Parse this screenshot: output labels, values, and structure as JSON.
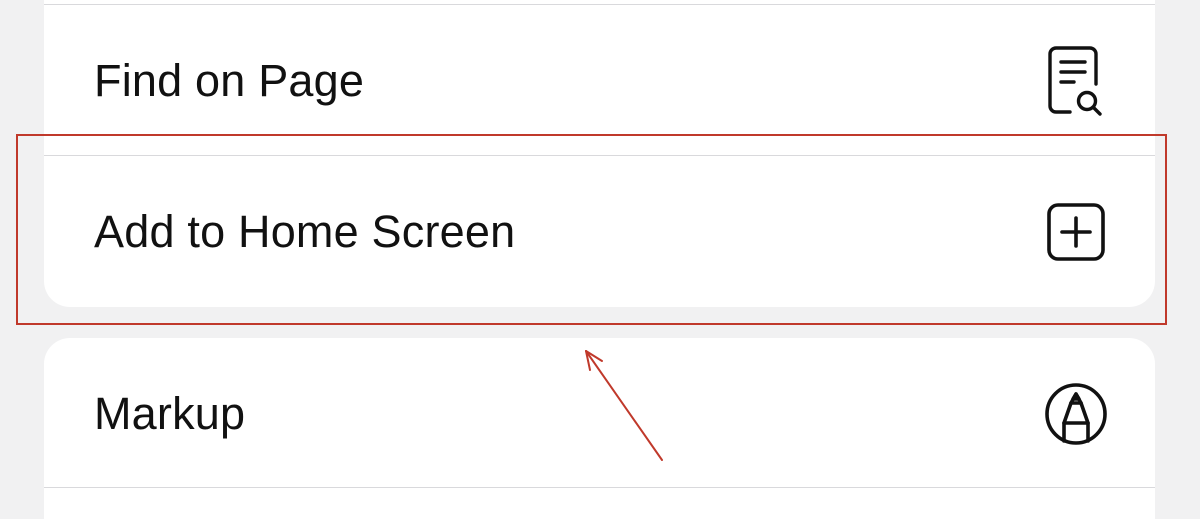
{
  "menu": {
    "group1": {
      "items": [
        {
          "label": "Find on Page",
          "icon": "find-on-page-icon"
        },
        {
          "label": "Add to Home Screen",
          "icon": "add-square-icon"
        }
      ]
    },
    "group2": {
      "items": [
        {
          "label": "Markup",
          "icon": "markup-pen-icon"
        }
      ]
    }
  },
  "annotation": {
    "highlighted_item": "Add to Home Screen",
    "color": "#c0392b"
  },
  "colors": {
    "background": "#f1f1f2",
    "card": "#ffffff",
    "text": "#111111",
    "separator": "#d9d9dc"
  }
}
